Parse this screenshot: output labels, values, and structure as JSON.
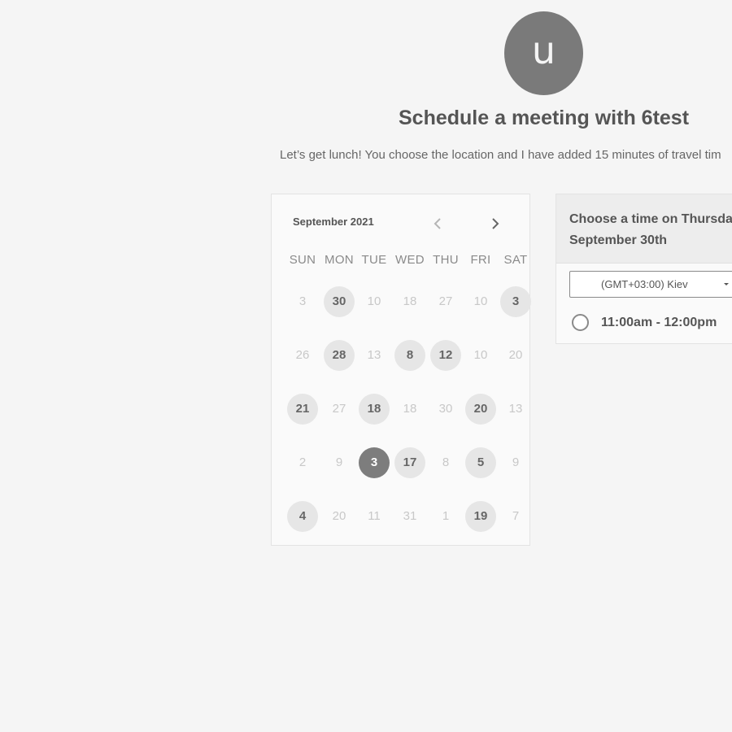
{
  "host": {
    "avatar_initial": "u",
    "title": "Schedule a meeting with 6test",
    "description": "Let’s get lunch! You choose the location and I have added 15 minutes of travel tim"
  },
  "calendar": {
    "month_label": "September 2021",
    "prev_icon": "chevron-left-icon",
    "next_icon": "chevron-right-icon",
    "weekdays": [
      "SUN",
      "MON",
      "TUE",
      "WED",
      "THU",
      "FRI",
      "SAT"
    ],
    "weeks": [
      [
        {
          "label": "3",
          "state": "disabled"
        },
        {
          "label": "30",
          "state": "available"
        },
        {
          "label": "10",
          "state": "disabled"
        },
        {
          "label": "18",
          "state": "disabled"
        },
        {
          "label": "27",
          "state": "disabled"
        },
        {
          "label": "10",
          "state": "disabled"
        },
        {
          "label": "3",
          "state": "available"
        }
      ],
      [
        {
          "label": "26",
          "state": "disabled"
        },
        {
          "label": "28",
          "state": "available"
        },
        {
          "label": "13",
          "state": "disabled"
        },
        {
          "label": "8",
          "state": "available"
        },
        {
          "label": "12",
          "state": "available"
        },
        {
          "label": "10",
          "state": "disabled"
        },
        {
          "label": "20",
          "state": "disabled"
        }
      ],
      [
        {
          "label": "21",
          "state": "available"
        },
        {
          "label": "27",
          "state": "disabled"
        },
        {
          "label": "18",
          "state": "available"
        },
        {
          "label": "18",
          "state": "disabled"
        },
        {
          "label": "30",
          "state": "disabled"
        },
        {
          "label": "20",
          "state": "available"
        },
        {
          "label": "13",
          "state": "disabled"
        }
      ],
      [
        {
          "label": "2",
          "state": "disabled"
        },
        {
          "label": "9",
          "state": "disabled"
        },
        {
          "label": "3",
          "state": "selected"
        },
        {
          "label": "17",
          "state": "available"
        },
        {
          "label": "8",
          "state": "disabled"
        },
        {
          "label": "5",
          "state": "available"
        },
        {
          "label": "9",
          "state": "disabled"
        }
      ],
      [
        {
          "label": "4",
          "state": "available"
        },
        {
          "label": "20",
          "state": "disabled"
        },
        {
          "label": "11",
          "state": "disabled"
        },
        {
          "label": "31",
          "state": "disabled"
        },
        {
          "label": "1",
          "state": "disabled"
        },
        {
          "label": "19",
          "state": "available"
        },
        {
          "label": "7",
          "state": "disabled"
        }
      ]
    ]
  },
  "time_panel": {
    "heading_line1": "Choose a time on Thursday",
    "heading_line2": "September 30th",
    "timezone": "(GMT+03:00) Kiev",
    "slots": [
      {
        "label": "11:00am - 12:00pm"
      }
    ]
  },
  "colors": {
    "background": "#f5f5f5",
    "avatar": "#7a7a7a",
    "selected_day": "#7d7d7d",
    "available_day": "#e6e6e6"
  }
}
